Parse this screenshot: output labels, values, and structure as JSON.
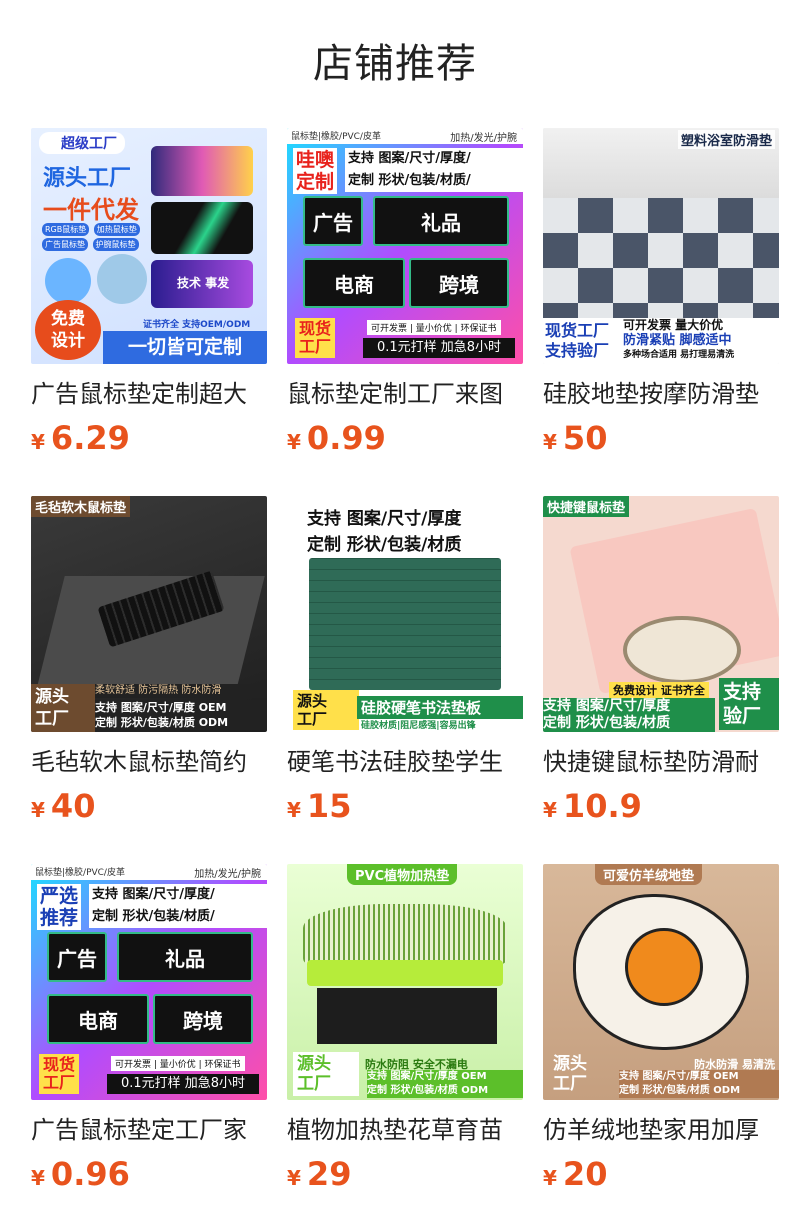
{
  "page": {
    "title": "店铺推荐"
  },
  "colors": {
    "price": "#e8531d"
  },
  "products": [
    {
      "name": "广告鼠标垫定制超大",
      "currency": "¥",
      "price": "6.29",
      "thumb": {
        "brand": "超级工厂",
        "line1": "源头工厂",
        "line2": "一件代发",
        "tags": [
          "RGB鼠标垫",
          "加热鼠标垫",
          "广告鼠标垫",
          "护腕鼠标垫"
        ],
        "badge": "免费\n设计",
        "note": "证书齐全 支持OEM/ODM",
        "footer": "一切皆可定制",
        "mini_text": "技术 事发"
      }
    },
    {
      "name": "鼠标垫定制工厂来图",
      "currency": "¥",
      "price": "0.99",
      "thumb": {
        "top_left": "鼠标垫|橡胶/PVC/皮革",
        "top_right": "加热/发光/护腕",
        "side": "哇噢\n定制",
        "head": "支持 图案/尺寸/厚度/\n定制 形状/包装/材质/",
        "blocks": [
          "广告",
          "礼品",
          "电商",
          "跨境"
        ],
        "stock": "现货\n工厂",
        "chips": "可开发票 | 量小价优 | 环保证书",
        "promo": "0.1元打样  加急8小时"
      }
    },
    {
      "name": "硅胶地垫按摩防滑垫",
      "currency": "¥",
      "price": "50",
      "thumb": {
        "top": "塑料浴室防滑垫",
        "left": "现货工厂\n支持验厂",
        "right1": "可开发票 量大价优",
        "right2": "防滑紧贴 脚感适中",
        "right3": "多种场合适用 易打理易清洗"
      }
    },
    {
      "name": "毛毡软木鼠标垫简约",
      "currency": "¥",
      "price": "40",
      "thumb": {
        "top": "毛毡软木鼠标垫",
        "left": "源头\n工厂",
        "row1": "柔软舒适 防污隔热 防水防滑",
        "row2": "支持 图案/尺寸/厚度 OEM\n定制 形状/包装/材质 ODM"
      }
    },
    {
      "name": "硬笔书法硅胶垫学生",
      "currency": "¥",
      "price": "15",
      "thumb": {
        "head": "支持 图案/尺寸/厚度\n定制 形状/包装/材质",
        "left": "源头\n工厂",
        "banner": "硅胶硬笔书法垫板",
        "sub": "硅胶材质|阻尼感强|容易出锋"
      }
    },
    {
      "name": "快捷键鼠标垫防滑耐",
      "currency": "¥",
      "price": "10.9",
      "thumb": {
        "top": "快捷键鼠标垫",
        "mid": "免费设计 证书齐全",
        "right": "支持\n验厂",
        "row": "支持 图案/尺寸/厚度\n定制 形状/包装/材质"
      }
    },
    {
      "name": "广告鼠标垫定工厂家",
      "currency": "¥",
      "price": "0.96",
      "thumb": {
        "top_left": "鼠标垫|橡胶/PVC/皮革",
        "top_right": "加热/发光/护腕",
        "side": "严选\n推荐",
        "head": "支持 图案/尺寸/厚度/\n定制 形状/包装/材质/",
        "blocks": [
          "广告",
          "礼品",
          "电商",
          "跨境"
        ],
        "stock": "现货\n工厂",
        "chips": "可开发票 | 量小价优 | 环保证书",
        "promo": "0.1元打样  加急8小时"
      }
    },
    {
      "name": "植物加热垫花草育苗",
      "currency": "¥",
      "price": "29",
      "thumb": {
        "top": "PVC植物加热垫",
        "left": "源头\n工厂",
        "row1": "防水防阻 安全不漏电",
        "row2": "支持 图案/尺寸/厚度 OEM\n定制 形状/包装/材质 ODM"
      }
    },
    {
      "name": "仿羊绒地垫家用加厚",
      "currency": "¥",
      "price": "20",
      "thumb": {
        "top": "可爱仿羊绒地垫",
        "left": "源头\n工厂",
        "row1": "防水防滑 易清洗",
        "row2": "支持 图案/尺寸/厚度 OEM\n定制 形状/包装/材质 ODM"
      }
    }
  ]
}
